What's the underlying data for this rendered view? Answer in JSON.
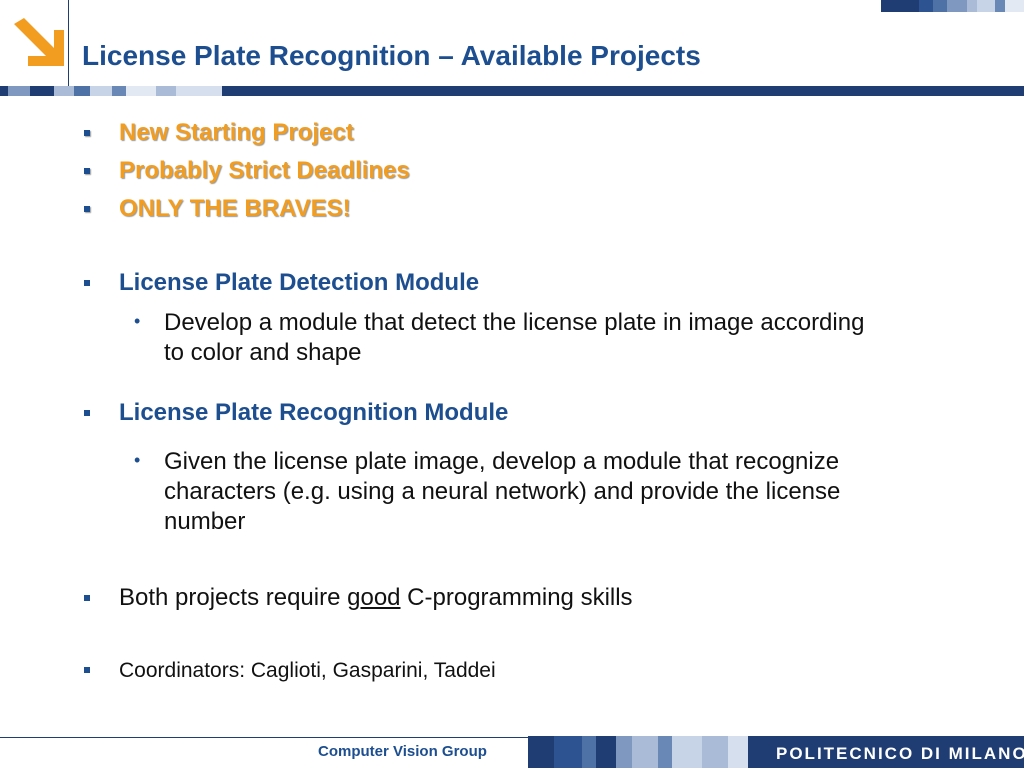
{
  "header": {
    "title": "License Plate Recognition – Available Projects",
    "logo_icon": "arrow-down-right-icon",
    "accent_color": "#f29d1f",
    "brand_color": "#1d4e8f"
  },
  "content": {
    "highlights": [
      "New Starting Project",
      "Probably Strict Deadlines",
      "ONLY THE BRAVES!"
    ],
    "detection": {
      "heading": "License Plate Detection Module",
      "desc_line1": "Develop a module that detect the license plate in image according",
      "desc_line2": "to color and shape"
    },
    "recognition": {
      "heading": "License Plate Recognition Module",
      "desc_line1": "Given the license plate image, develop a module that recognize",
      "desc_line2": "characters (e.g. using a neural network) and provide the license",
      "desc_line3": "number"
    },
    "requirement": {
      "prefix": "Both projects require ",
      "emphasis": "good",
      "suffix": " C-programming skills"
    },
    "coordinators": "Coordinators: Caglioti, Gasparini, Taddei"
  },
  "footer": {
    "group": "Computer Vision Group",
    "institution": "POLITECNICO DI MILANO"
  }
}
